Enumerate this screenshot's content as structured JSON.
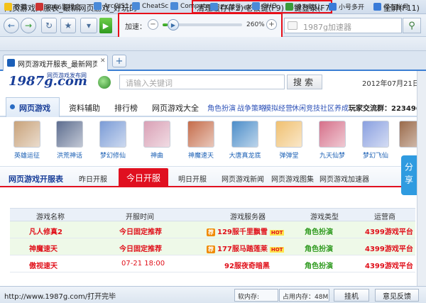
{
  "window": {
    "title": "网页游戏开服表_最新网页游戏_好玩的",
    "menu": {
      "clear_cache": "清理缓存(F2)",
      "boss_key": "老板键(F9)",
      "one_click_login": "一键登录(F7)",
      "fullscreen": "全屏(F11)"
    }
  },
  "toolbar": {
    "back_icon": "back-arrow-icon",
    "forward_icon": "forward-arrow-icon",
    "refresh_icon": "refresh-icon",
    "favorite_icon": "star-icon",
    "play_icon": "play-icon"
  },
  "speed": {
    "label": "加速：",
    "value": "260%",
    "level_fraction": 0.06
  },
  "search": {
    "placeholder": "1987g加速器"
  },
  "bookmarks": [
    {
      "label": "收藏"
    },
    {
      "label": "9966影视盒"
    },
    {
      "label": "ArcGIS1"
    },
    {
      "label": "CheatSc"
    },
    {
      "label": "Compute"
    },
    {
      "label": "EX鼓号 ex"
    },
    {
      "label": "GHO"
    },
    {
      "label": "设为默认"
    },
    {
      "label": "小号多开"
    },
    {
      "label": "保存帐号"
    }
  ],
  "tabs": {
    "active_label": "网页游戏开服表_最新网页..."
  },
  "site": {
    "logo": "1987g.com",
    "logo_sub": "网页游戏发布网",
    "search_placeholder": "请输入关键词",
    "search_button": "搜索",
    "date": "2012年07月21日 18"
  },
  "nav": {
    "items": [
      "网页游戏",
      "资料辅助",
      "排行榜",
      "网页游戏大全"
    ],
    "subs": [
      "角色扮演",
      "战争策略",
      "模拟经营",
      "休闲竞技",
      "社区养成"
    ],
    "right": "玩家交流群：223496"
  },
  "games": [
    {
      "name": "英雄运征",
      "color": "#c8a27a"
    },
    {
      "name": "洪荒神话",
      "color": "#5d6d8f"
    },
    {
      "name": "梦幻修仙",
      "color": "#7a9bd6"
    },
    {
      "name": "神曲",
      "color": "#d9a0b5"
    },
    {
      "name": "神魔速天",
      "color": "#c56c4a"
    },
    {
      "name": "大唐真龙底",
      "color": "#4c8dc9"
    },
    {
      "name": "弹弹堂",
      "color": "#f0c070"
    },
    {
      "name": "九天仙梦",
      "color": "#d6708a"
    },
    {
      "name": "梦幻飞仙",
      "color": "#8aa0e0"
    },
    {
      "name": "",
      "color": "#9a6a4a"
    }
  ],
  "subbar": {
    "title": "网页游戏开服表",
    "tabs": [
      "昨日开服",
      "今日开服",
      "明日开服",
      "网页游戏新闻",
      "网页游戏图集",
      "网页游戏加速器"
    ],
    "share": "分享"
  },
  "table": {
    "headers": [
      "游戏名称",
      "开服时间",
      "游戏服务器",
      "游戏类型",
      "运营商"
    ],
    "rows": [
      {
        "name": "凡人修真2",
        "time": "今日固定推荐",
        "server": "129服千里飘雪",
        "rec": "荐",
        "hot": "HOT",
        "type": "角色扮演",
        "operator": "4399游戏平台",
        "style": "green"
      },
      {
        "name": "神魔速天",
        "time": "今日固定推荐",
        "server": "177服马踏莲莱",
        "rec": "荐",
        "hot": "HOT",
        "type": "角色扮演",
        "operator": "4399游戏平台",
        "style": "green"
      },
      {
        "name": "傲视速天",
        "time": "07-21 18:00",
        "server": "92服夜奇暗黑",
        "rec": "",
        "hot": "",
        "type": "角色扮演",
        "operator": "4399游戏平台",
        "style": "white"
      }
    ]
  },
  "status": {
    "url": "http://www.1987g.com/打开完毕",
    "mem1": "软内存:",
    "mem2": "占用内存：48M",
    "hang": "挂机",
    "feedback": "意见反馈"
  }
}
